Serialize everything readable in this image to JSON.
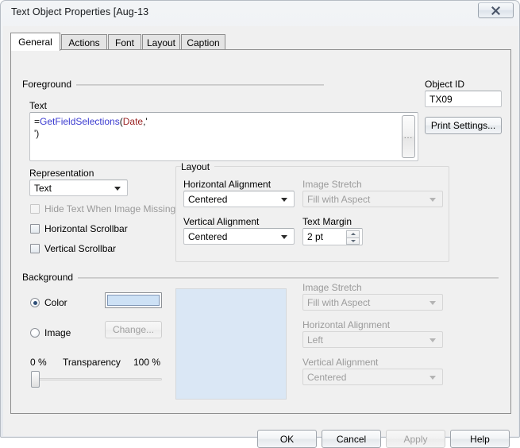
{
  "window": {
    "title": "Text Object Properties [Aug-13",
    "close_icon": "close-icon"
  },
  "tabs": [
    {
      "label": "General",
      "active": true
    },
    {
      "label": "Actions",
      "active": false
    },
    {
      "label": "Font",
      "active": false
    },
    {
      "label": "Layout",
      "active": false
    },
    {
      "label": "Caption",
      "active": false
    }
  ],
  "foreground": {
    "group_label": "Foreground",
    "text_label": "Text",
    "text_value": {
      "equals": "=",
      "function": "GetFieldSelections",
      "open_paren": "(",
      "field": "Date",
      "comma_quote": ",'",
      "line2": "')"
    },
    "ellipsis_button": "...",
    "representation": {
      "label": "Representation",
      "value": "Text"
    },
    "checkboxes": [
      {
        "label": "Hide Text When Image Missing",
        "checked": false,
        "disabled": true
      },
      {
        "label": "Horizontal Scrollbar",
        "checked": false,
        "disabled": false
      },
      {
        "label": "Vertical Scrollbar",
        "checked": false,
        "disabled": false
      }
    ]
  },
  "object": {
    "id_label": "Object ID",
    "id_value": "TX09",
    "print_settings_label": "Print Settings..."
  },
  "layout_group": {
    "group_label": "Layout",
    "horizontal_alignment": {
      "label": "Horizontal Alignment",
      "value": "Centered",
      "disabled": false
    },
    "vertical_alignment": {
      "label": "Vertical Alignment",
      "value": "Centered",
      "disabled": false
    },
    "image_stretch": {
      "label": "Image Stretch",
      "value": "Fill with Aspect",
      "disabled": true
    },
    "text_margin": {
      "label": "Text Margin",
      "value": "2 pt"
    }
  },
  "background": {
    "group_label": "Background",
    "color_radio": {
      "label": "Color",
      "selected": true
    },
    "image_radio": {
      "label": "Image",
      "selected": false
    },
    "change_button": {
      "label": "Change...",
      "disabled": true
    },
    "color_value": "#cde1f5",
    "preview_color": "#dae7f5",
    "transparency": {
      "label": "Transparency",
      "min_label": "0 %",
      "max_label": "100 %",
      "value": 0
    },
    "image_stretch": {
      "label": "Image Stretch",
      "value": "Fill with Aspect",
      "disabled": true
    },
    "horizontal_alignment": {
      "label": "Horizontal Alignment",
      "value": "Left",
      "disabled": true
    },
    "vertical_alignment": {
      "label": "Vertical Alignment",
      "value": "Centered",
      "disabled": true
    }
  },
  "footer": {
    "ok": {
      "label": "OK",
      "disabled": false
    },
    "cancel": {
      "label": "Cancel",
      "disabled": false
    },
    "apply": {
      "label": "Apply",
      "disabled": true
    },
    "help": {
      "label": "Help",
      "disabled": false
    }
  }
}
